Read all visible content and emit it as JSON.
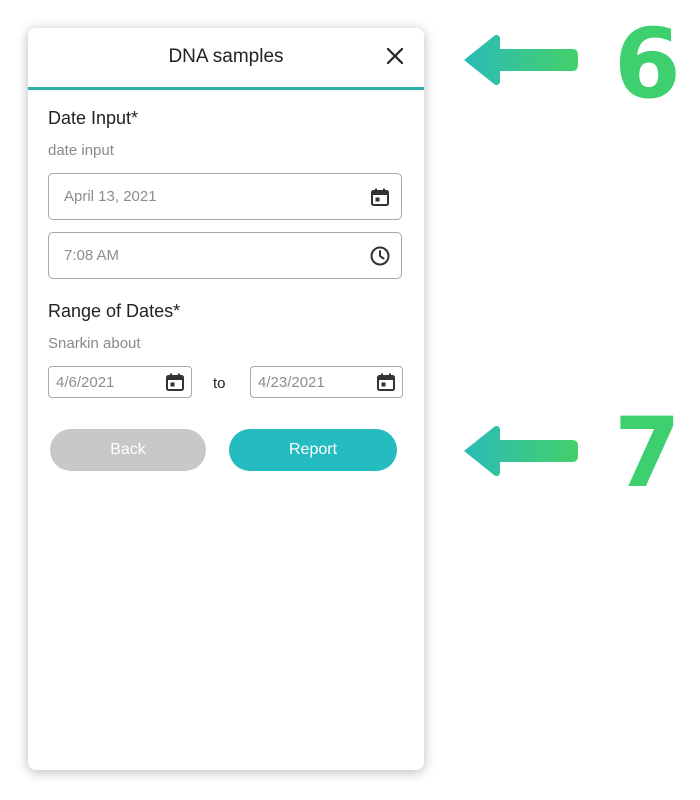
{
  "dialog": {
    "title": "DNA samples",
    "close_icon": "close-icon"
  },
  "date_input": {
    "label": "Date Input*",
    "hint": "date input",
    "date_value": "April 13, 2021",
    "date_icon": "calendar-icon",
    "time_value": "7:08 AM",
    "time_icon": "clock-icon"
  },
  "date_range": {
    "label": "Range of Dates*",
    "hint": "Snarkin about",
    "start_value": "4/6/2021",
    "separator": "to",
    "end_value": "4/23/2021",
    "calendar_icon": "calendar-icon"
  },
  "actions": {
    "back_label": "Back",
    "report_label": "Report"
  },
  "annotations": {
    "step_top": "6",
    "step_bottom": "7",
    "arrow_icon": "left-arrow-icon",
    "accent_color": "#3ecf6f",
    "arrow_gradient_start": "#2bbbb8"
  },
  "colors": {
    "header_underline": "#2ab3ad",
    "report_button": "#24bcc0",
    "back_button_disabled": "#c8c8c8"
  }
}
